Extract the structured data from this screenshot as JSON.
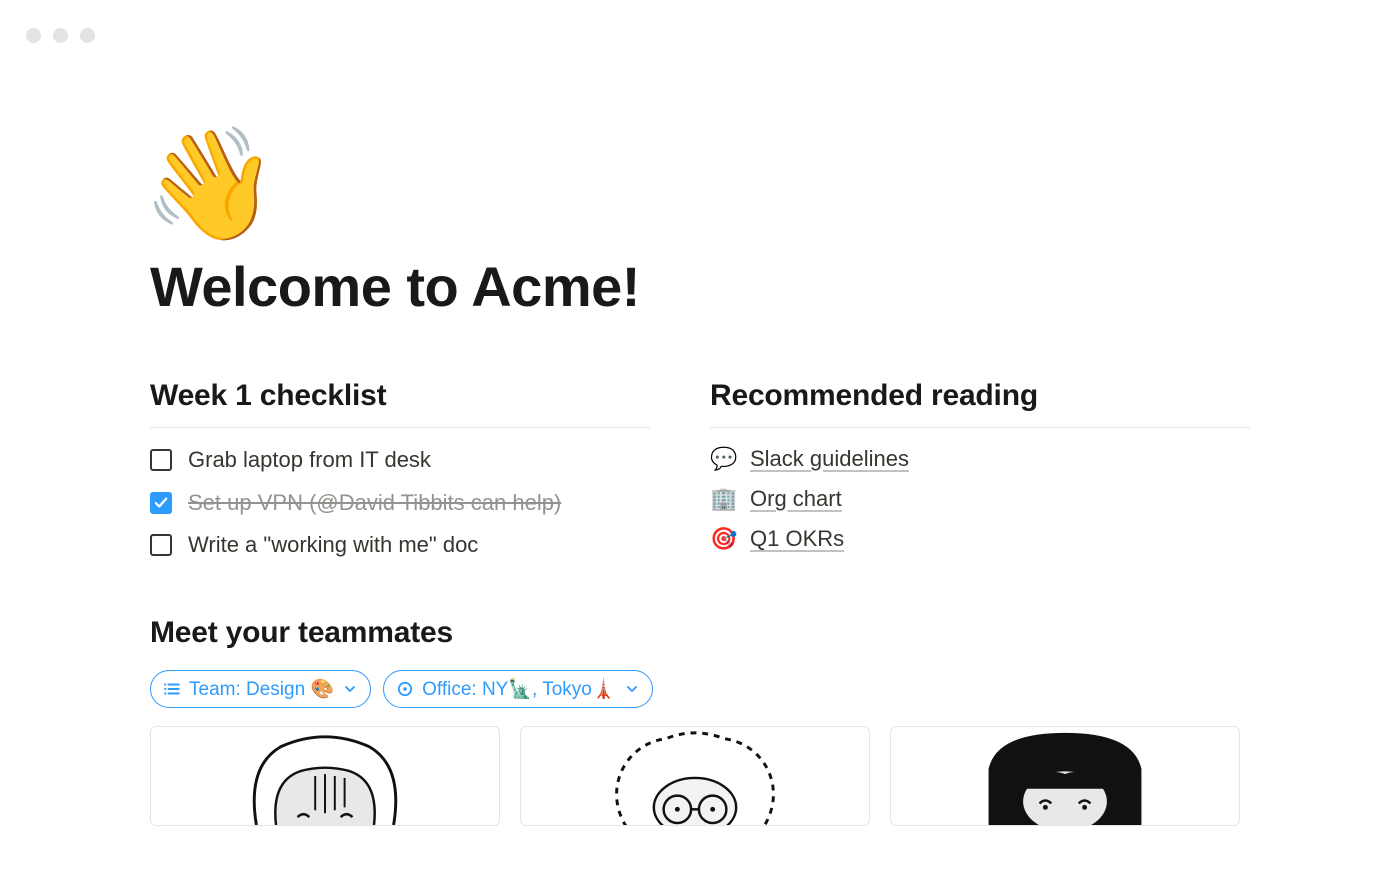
{
  "page": {
    "icon": "👋",
    "title": "Welcome to Acme!"
  },
  "checklist": {
    "heading": "Week 1 checklist",
    "items": [
      {
        "text": "Grab laptop from IT desk",
        "done": false
      },
      {
        "text": "Set up VPN (@David Tibbits can help)",
        "done": true
      },
      {
        "text": "Write a \"working with me\" doc",
        "done": false
      }
    ]
  },
  "reading": {
    "heading": "Recommended reading",
    "items": [
      {
        "emoji": "💬",
        "label": "Slack guidelines"
      },
      {
        "emoji": "🏢",
        "label": "Org chart"
      },
      {
        "emoji": "🎯",
        "label": "Q1 OKRs"
      }
    ]
  },
  "teammates": {
    "heading": "Meet your teammates",
    "filters": [
      {
        "icon": "list",
        "label": "Team: Design 🎨"
      },
      {
        "icon": "target",
        "label": "Office: NY🗽, Tokyo🗼"
      }
    ]
  }
}
